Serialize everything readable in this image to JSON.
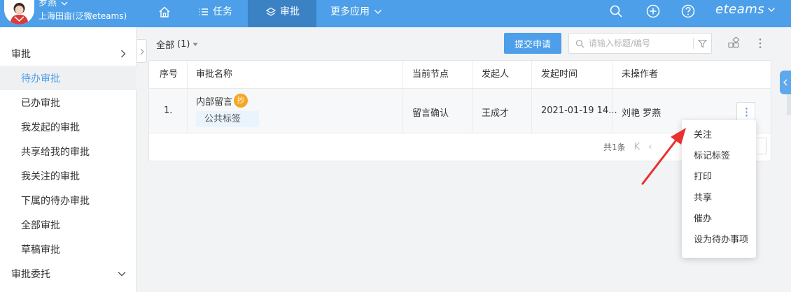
{
  "user": {
    "name": "罗燕",
    "org": "上海田亩(泛微eteams)"
  },
  "nav": {
    "task_label": "任务",
    "approval_label": "审批",
    "more_apps_label": "更多应用"
  },
  "brand": "eteams",
  "sidebar": {
    "section_title": "审批",
    "items": [
      {
        "label": "待办审批",
        "active": true
      },
      {
        "label": "已办审批"
      },
      {
        "label": "我发起的审批"
      },
      {
        "label": "共享给我的审批"
      },
      {
        "label": "我关注的审批"
      },
      {
        "label": "下属的待办审批"
      },
      {
        "label": "全部审批"
      },
      {
        "label": "草稿审批"
      }
    ],
    "delegate_title": "审批委托"
  },
  "toolbar": {
    "filter_label": "全部",
    "filter_count": "(1)",
    "submit_label": "提交申请",
    "search_placeholder": "请输入标题/编号"
  },
  "table": {
    "columns": [
      "序号",
      "审批名称",
      "当前节点",
      "发起人",
      "发起时间",
      "未操作者"
    ],
    "rows": [
      {
        "index": "1.",
        "name": "内部留言",
        "badge": "抄",
        "tag": "公共标签",
        "node": "留言确认",
        "initiator": "王成才",
        "time": "2021-01-19 14...",
        "pending": "刘艳 罗燕"
      }
    ],
    "total": "共1条"
  },
  "row_menu": {
    "items": [
      "关注",
      "标记标签",
      "打印",
      "共享",
      "催办",
      "设为待办事项"
    ]
  },
  "colors": {
    "topbar": "#4c9fe8",
    "active_nav": "#3a82c4",
    "accent": "#4c9fe8",
    "badge": "#f5a623",
    "arrow": "#e8312f"
  }
}
